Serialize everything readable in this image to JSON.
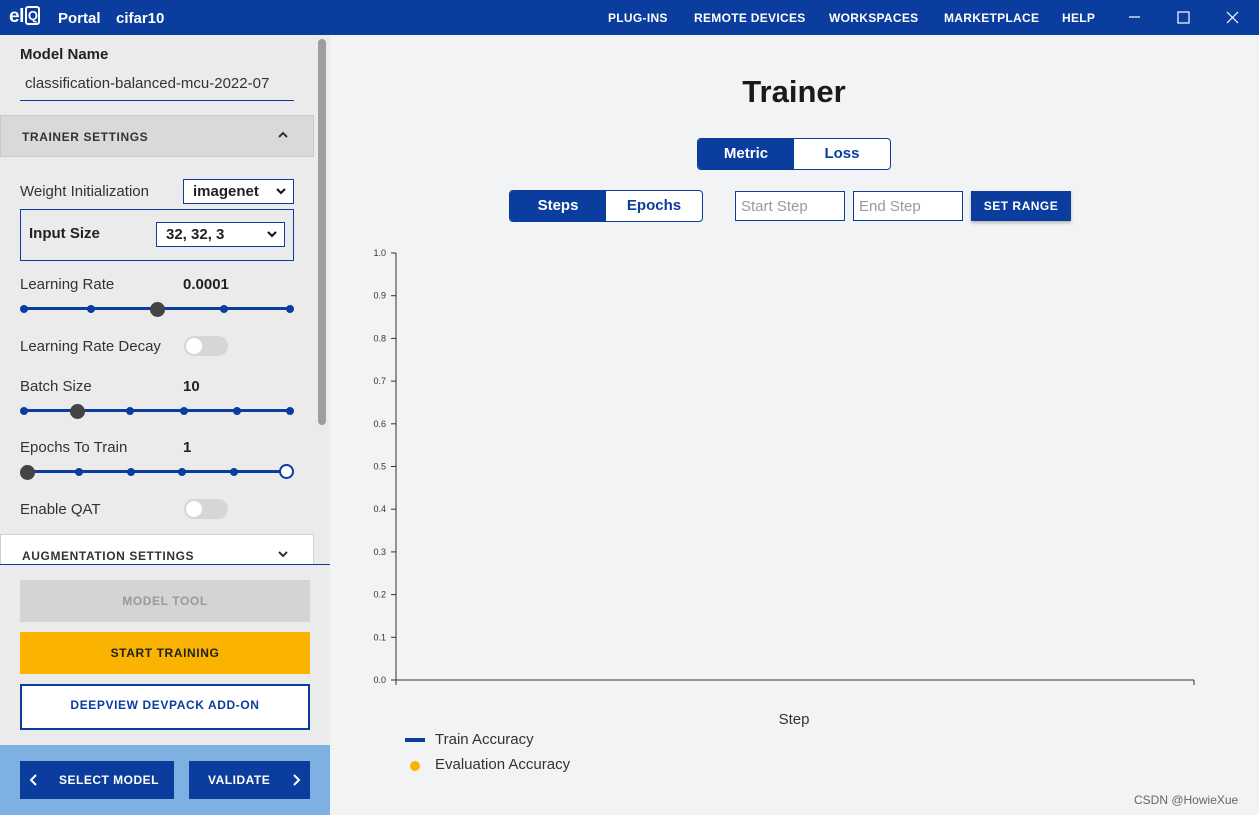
{
  "app": {
    "logo": "elQ",
    "portal": "Portal",
    "project": "cifar10"
  },
  "nav": [
    "PLUG-INS",
    "REMOTE DEVICES",
    "WORKSPACES",
    "MARKETPLACE",
    "HELP"
  ],
  "window_controls": {
    "minimize": "—",
    "maximize": "☐",
    "close": "✕"
  },
  "sidebar": {
    "model_name_label": "Model Name",
    "model_name_value": "classification-balanced-mcu-2022-07",
    "trainer_settings": "TRAINER SETTINGS",
    "weight_init_label": "Weight Initialization",
    "weight_init_value": "imagenet",
    "input_size_label": "Input Size",
    "input_size_value": "32, 32, 3",
    "learning_rate_label": "Learning Rate",
    "learning_rate_value": "0.0001",
    "learning_rate_decay_label": "Learning Rate Decay",
    "learning_rate_decay_on": false,
    "batch_size_label": "Batch Size",
    "batch_size_value": "10",
    "epochs_label": "Epochs To Train",
    "epochs_value": "1",
    "enable_qat_label": "Enable QAT",
    "enable_qat_on": false,
    "augmentation_settings": "AUGMENTATION SETTINGS",
    "model_tool": "MODEL TOOL",
    "start_training": "START TRAINING",
    "deepview": "DEEPVIEW DEVPACK ADD-ON",
    "select_model": "SELECT MODEL",
    "validate": "VALIDATE"
  },
  "sliders": {
    "learning_rate": {
      "stops": 5,
      "selected_index": 2
    },
    "batch_size": {
      "stops": 6,
      "selected_index": 1
    },
    "epochs": {
      "stops": 6,
      "selected_index": 0
    }
  },
  "main": {
    "title": "Trainer",
    "metric_tab": "Metric",
    "loss_tab": "Loss",
    "steps_tab": "Steps",
    "epochs_tab": "Epochs",
    "start_step_placeholder": "Start Step",
    "end_step_placeholder": "End Step",
    "set_range": "SET RANGE",
    "legend_train": "Train Accuracy",
    "legend_eval": "Evaluation Accuracy"
  },
  "chart_data": {
    "type": "line",
    "xlabel": "Step",
    "ylabel": "",
    "ylim": [
      0.0,
      1.0
    ],
    "yticks": [
      "0.0",
      "0.1",
      "0.2",
      "0.3",
      "0.4",
      "0.5",
      "0.6",
      "0.7",
      "0.8",
      "0.9",
      "1.0"
    ],
    "series": [
      {
        "name": "Train Accuracy",
        "values": []
      },
      {
        "name": "Evaluation Accuracy",
        "values": []
      }
    ]
  },
  "colors": {
    "primary": "#0b3d9e",
    "accent": "#f9b300",
    "train_series": "#0b3d9e",
    "eval_series": "#f9b300"
  },
  "watermark": "CSDN @HowieXue"
}
